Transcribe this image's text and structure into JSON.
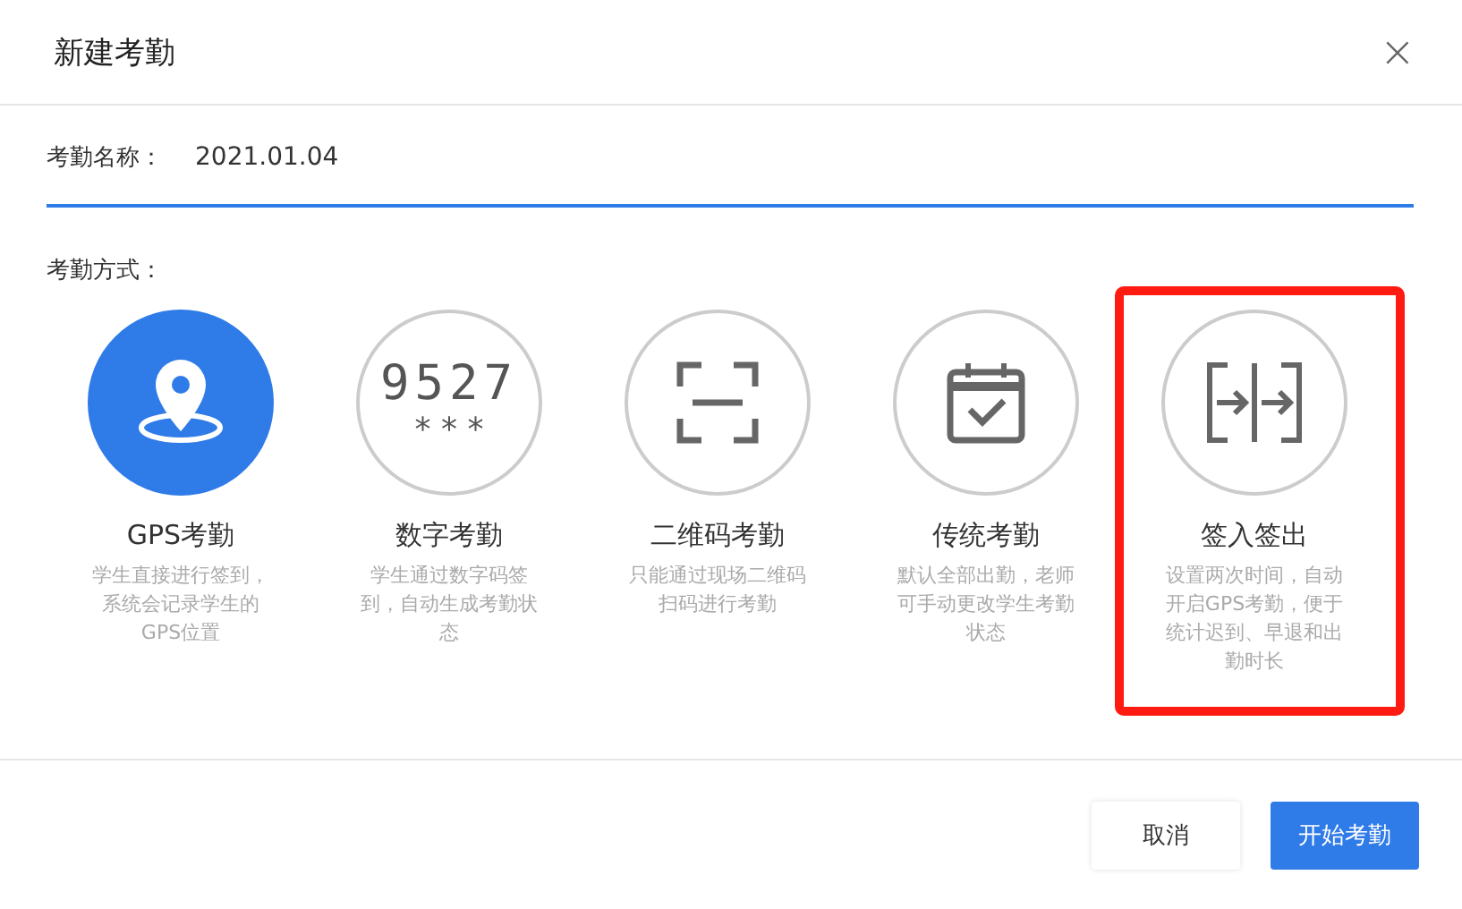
{
  "dialog": {
    "title": "新建考勤",
    "close": "×"
  },
  "name_field": {
    "label": "考勤名称：",
    "value": "2021.01.04",
    "focused": true
  },
  "methods_label": "考勤方式：",
  "methods": [
    {
      "kind": "gps",
      "title": "GPS考勤",
      "description": "学生直接进行签到，系统会记录学生的GPS位置",
      "selected": true,
      "highlighted": false
    },
    {
      "kind": "digits",
      "title": "数字考勤",
      "description": "学生通过数字码签到，自动生成考勤状态",
      "selected": false,
      "highlighted": false,
      "code": "9527",
      "mask": "* * *"
    },
    {
      "kind": "qrcode",
      "title": "二维码考勤",
      "description": "只能通过现场二维码扫码进行考勤",
      "selected": false,
      "highlighted": false
    },
    {
      "kind": "calendar",
      "title": "传统考勤",
      "description": "默认全部出勤，老师可手动更改学生考勤状态",
      "selected": false,
      "highlighted": false
    },
    {
      "kind": "inout",
      "title": "签入签出",
      "description": "设置两次时间，自动开启GPS考勤，便于统计迟到、早退和出勤时长",
      "selected": false,
      "highlighted": true
    }
  ],
  "buttons": [
    {
      "kind": "secondary",
      "label": "取消"
    },
    {
      "kind": "primary",
      "label": "开始考勤"
    }
  ]
}
